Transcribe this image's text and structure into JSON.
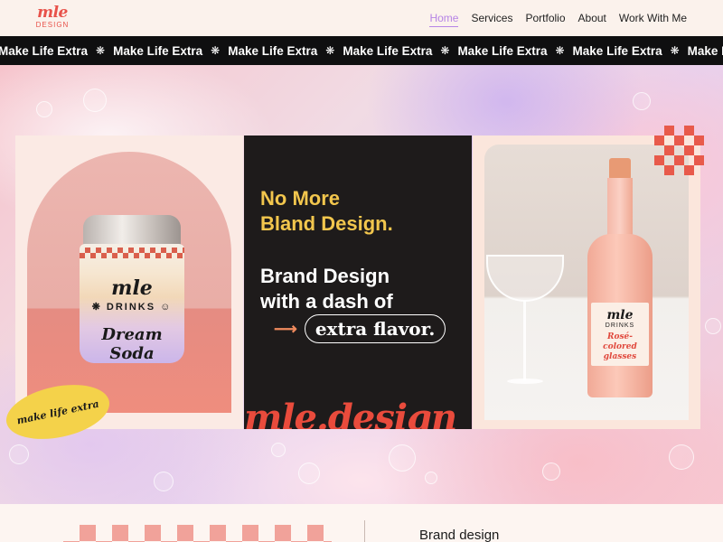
{
  "header": {
    "logo_mark": "mle",
    "logo_sub": "DESIGN",
    "nav": [
      {
        "label": "Home",
        "active": true
      },
      {
        "label": "Services",
        "active": false
      },
      {
        "label": "Portfolio",
        "active": false
      },
      {
        "label": "About",
        "active": false
      },
      {
        "label": "Work With Me",
        "active": false
      }
    ]
  },
  "marquee": {
    "text": "Make Life Extra",
    "separator": "❋",
    "repeat": 7
  },
  "hero": {
    "panel1": {
      "can_brand": "mle",
      "can_drinks": "❋ DRINKS ☺",
      "can_name": "Dream Soda",
      "sticker": "make life extra"
    },
    "panel2": {
      "headline_line1": "No More",
      "headline_line2": "Bland Design.",
      "sub_line1": "Brand Design",
      "sub_line2": "with a dash of",
      "arrow": "⟶",
      "pill": "extra flavor.",
      "footer_wordmark": "mle.design"
    },
    "panel3": {
      "bottle_brand": "mle",
      "bottle_drinks": "DRINKS",
      "bottle_name": "Rosé-colored glasses"
    }
  },
  "bottom": {
    "title": "Brand design"
  },
  "colors": {
    "accent_coral": "#e8524a",
    "nav_active": "#b684e6",
    "marquee_bg": "#0f0f10",
    "headline_yellow": "#f2c64d",
    "dark_panel": "#1e1b1b"
  }
}
